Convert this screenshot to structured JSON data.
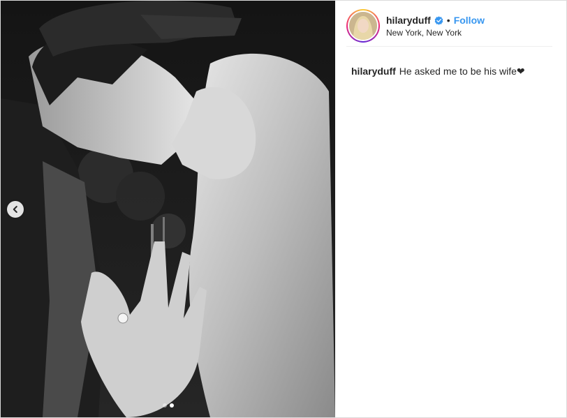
{
  "post": {
    "username": "hilaryduff",
    "separator": "•",
    "follow_label": "Follow",
    "location": "New York, New York",
    "caption_username": "hilaryduff",
    "caption_text": "He asked me to be his wife❤"
  },
  "carousel": {
    "slide_count": 2,
    "active_slide": 2
  },
  "icons": {
    "prev": "chevron-left-icon",
    "verified": "verified-badge-icon"
  },
  "colors": {
    "follow": "#3897f0",
    "verified": "#3897f0",
    "text": "#262626",
    "border": "#dbdbdb"
  }
}
